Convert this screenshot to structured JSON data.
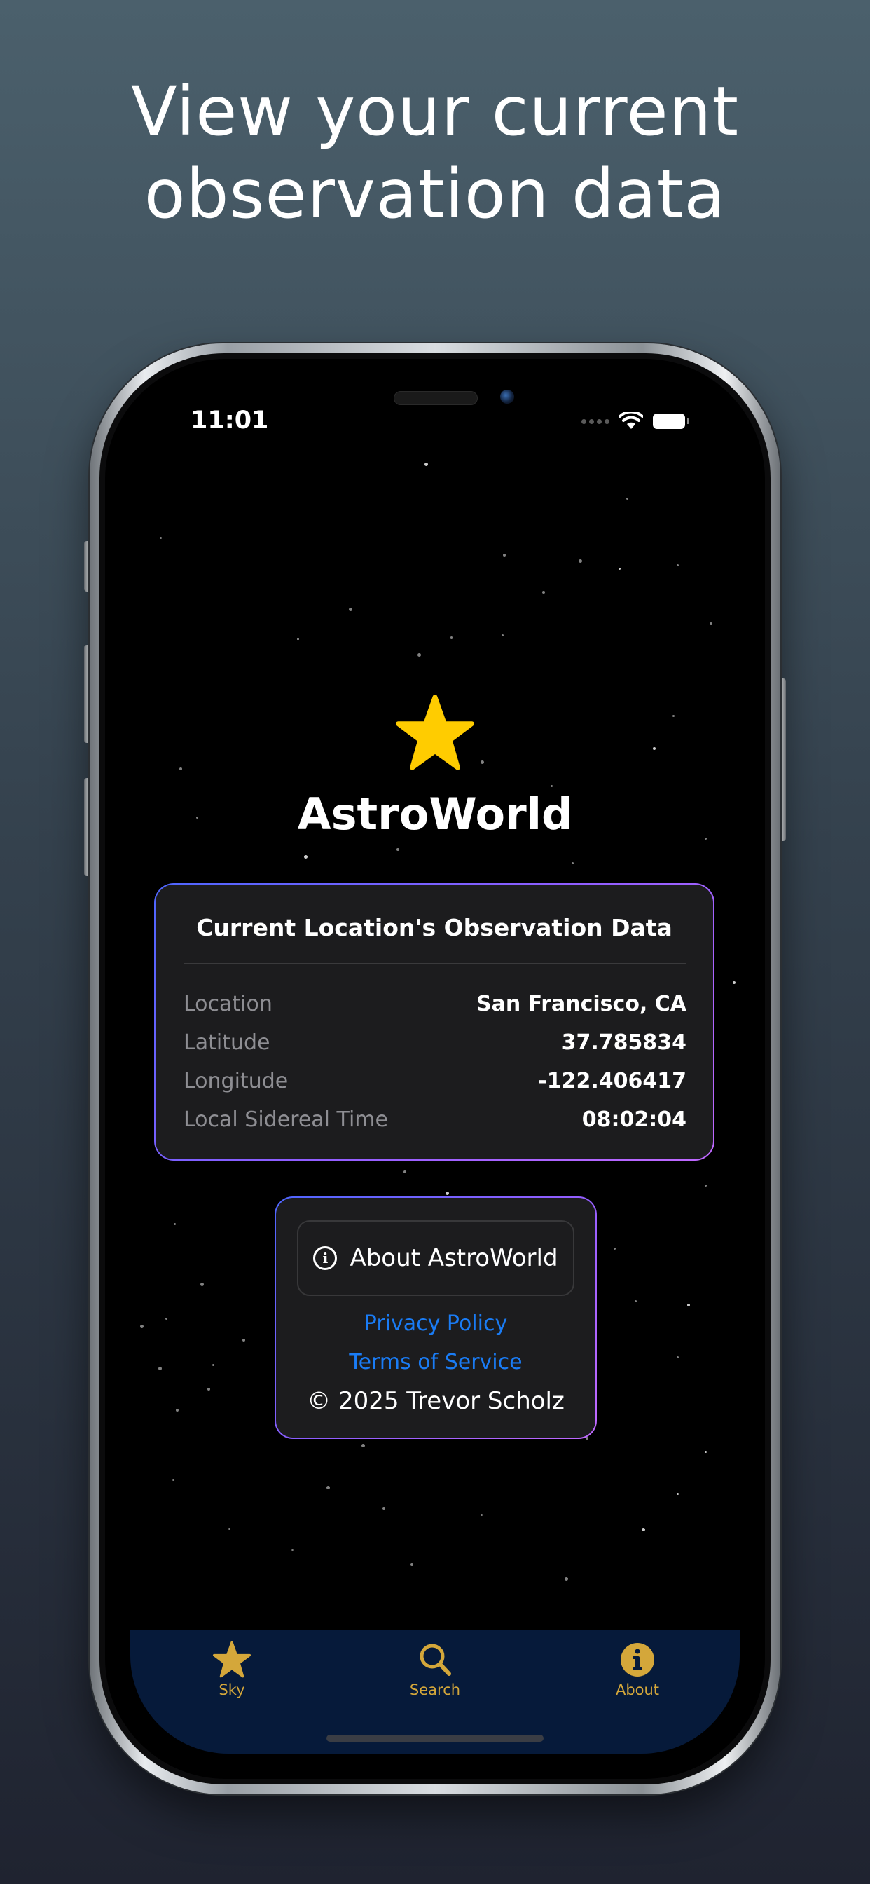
{
  "headline": {
    "line1": "View your current",
    "line2": "observation data"
  },
  "status_bar": {
    "time": "11:01"
  },
  "app": {
    "title": "AstroWorld",
    "star_color": "#ffcc00"
  },
  "observation": {
    "title": "Current Location's Observation Data",
    "rows": [
      {
        "label": "Location",
        "value": "San Francisco, CA"
      },
      {
        "label": "Latitude",
        "value": "37.785834"
      },
      {
        "label": "Longitude",
        "value": "-122.406417"
      },
      {
        "label": "Local Sidereal Time",
        "value": "08:02:04"
      }
    ]
  },
  "about_card": {
    "about_button": "About AstroWorld",
    "privacy_link": "Privacy Policy",
    "terms_link": "Terms of Service",
    "copyright": "© 2025 Trevor Scholz"
  },
  "tabs": [
    {
      "label": "Sky",
      "icon": "star-icon"
    },
    {
      "label": "Search",
      "icon": "magnifier-icon"
    },
    {
      "label": "About",
      "icon": "info-icon"
    }
  ],
  "colors": {
    "accent_gold": "#d4a73a",
    "link_blue": "#1a7cf5",
    "tabbar_bg": "#061a3a"
  }
}
